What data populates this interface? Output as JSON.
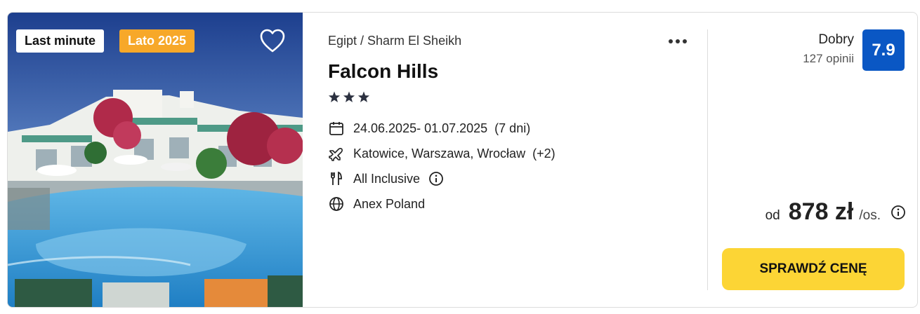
{
  "badges": {
    "last_minute": "Last minute",
    "season": "Lato 2025"
  },
  "icons": {
    "favorite": "heart-icon",
    "more": "more-dots-icon",
    "dates": "calendar-icon",
    "departure": "plane-icon",
    "board": "cutlery-icon",
    "operator": "globe-icon",
    "info": "info-icon"
  },
  "hotel": {
    "location": "Egipt / Sharm El Sheikh",
    "name": "Falcon Hills",
    "stars": 3,
    "dates": "24.06.2025- 01.07.2025",
    "duration": "(7 dni)",
    "departure_cities": "Katowice, Warszawa, Wrocław",
    "departure_extra": "(+2)",
    "board": "All Inclusive",
    "operator": "Anex Poland"
  },
  "rating": {
    "label": "Dobry",
    "count": "127 opinii",
    "score": "7.9"
  },
  "price": {
    "prefix": "od",
    "value": "878 zł",
    "per": "/os."
  },
  "cta": {
    "label": "SPRAWDŹ CENĘ"
  },
  "colors": {
    "rating_bg": "#0a57c4",
    "cta_bg": "#fcd535",
    "season_badge_bg": "#f7a829",
    "stars": "#2c3140"
  }
}
